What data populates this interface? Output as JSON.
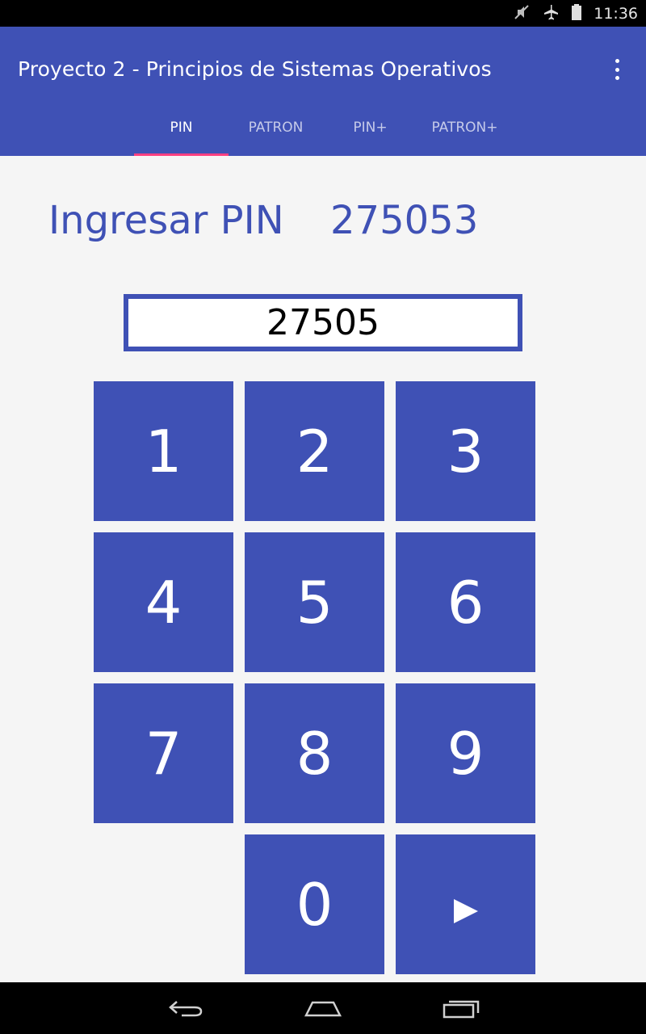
{
  "status_bar": {
    "time": "11:36",
    "icons": [
      "muted-icon",
      "airplane-icon",
      "battery-icon"
    ]
  },
  "app_bar": {
    "title": "Proyecto 2 - Principios de Sistemas Operativos",
    "menu_icon": "more-vert-icon",
    "tabs": [
      {
        "label": "PIN",
        "active": true
      },
      {
        "label": "PATRON",
        "active": false
      },
      {
        "label": "PIN+",
        "active": false
      },
      {
        "label": "PATRON+",
        "active": false
      }
    ]
  },
  "main": {
    "prompt_label": "Ingresar PIN",
    "target_pin": "275053",
    "pin_input_value": "27505",
    "keys": [
      "1",
      "2",
      "3",
      "4",
      "5",
      "6",
      "7",
      "8",
      "9",
      "0"
    ],
    "submit_key_icon": "play-arrow-icon"
  },
  "nav_bar": {
    "buttons": [
      "back-icon",
      "home-icon",
      "recents-icon"
    ]
  },
  "colors": {
    "primary": "#3f51b5",
    "accent": "#ff4081",
    "background": "#f5f5f5"
  }
}
